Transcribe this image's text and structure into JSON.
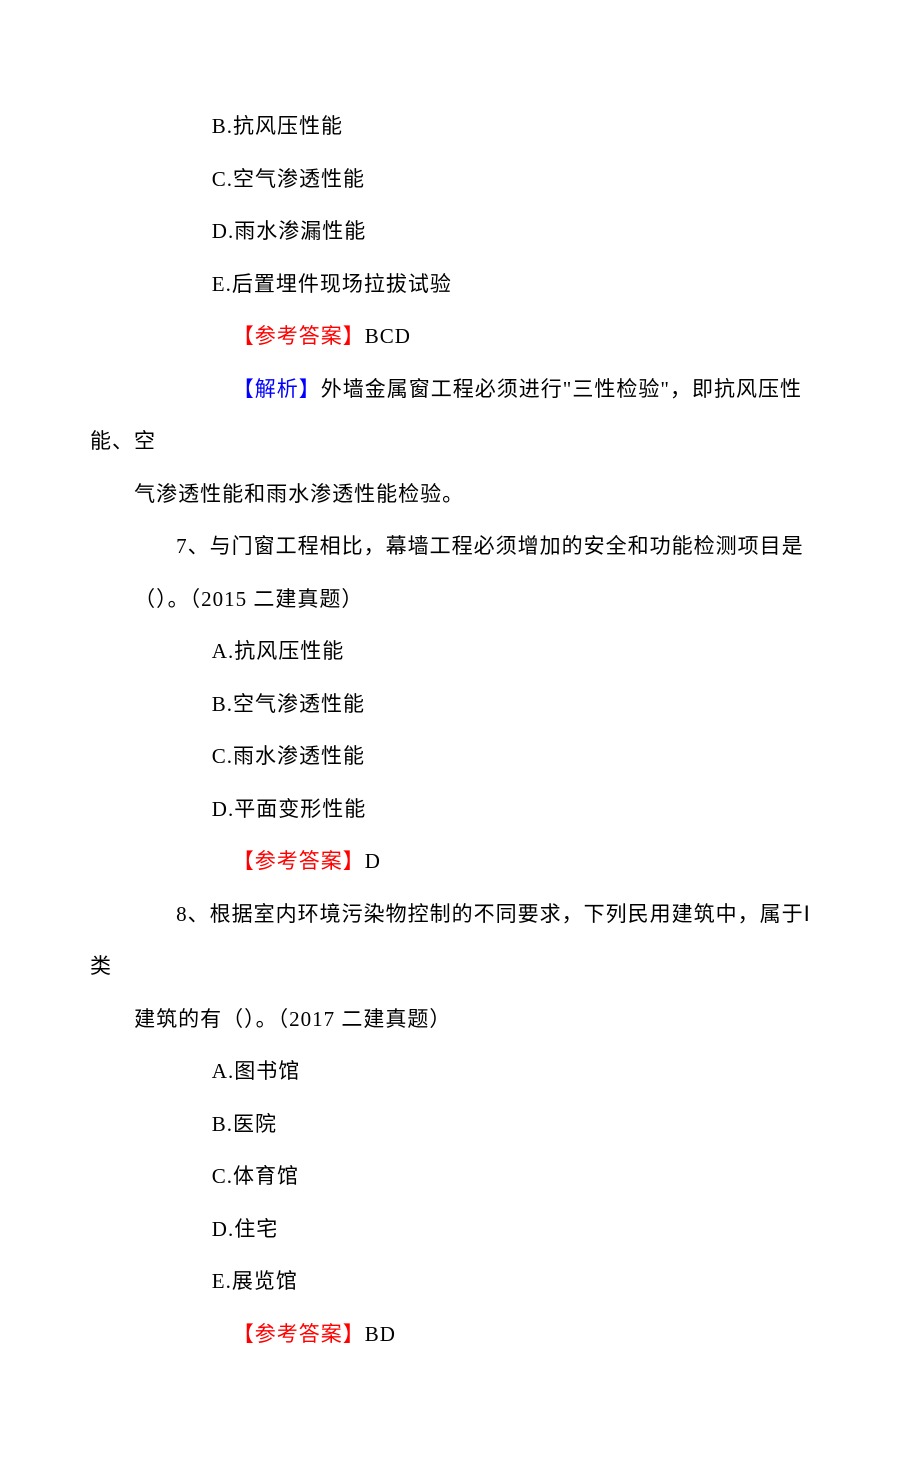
{
  "colors": {
    "red": "#ff0000",
    "blue": "#0000ff",
    "black": "#000000"
  },
  "lines": {
    "opt_b": "B.抗风压性能",
    "opt_c": "C.空气渗透性能",
    "opt_d": "D.雨水渗漏性能",
    "opt_e": "E.后置埋件现场拉拔试验",
    "ans6_label": "【参考答案】",
    "ans6_value": "BCD",
    "analysis_label": "【解析】",
    "analysis_part1": "外墙金属窗工程必须进行\"三性检验\"，即抗风压性能、空",
    "analysis_part2": "气渗透性能和雨水渗透性能检验。",
    "q7_part1": "7、与门窗工程相比，幕墙工程必须增加的安全和功能检测项目是",
    "q7_part2": "（）。（2015 二建真题）",
    "q7_a": "A.抗风压性能",
    "q7_b": "B.空气渗透性能",
    "q7_c": "C.雨水渗透性能",
    "q7_d": "D.平面变形性能",
    "ans7_label": "【参考答案】",
    "ans7_value": "D",
    "q8_part1": "8、根据室内环境污染物控制的不同要求，下列民用建筑中，属于Ⅰ类",
    "q8_part2": "建筑的有（）。（2017 二建真题）",
    "q8_a": "A.图书馆",
    "q8_b": "B.医院",
    "q8_c": "C.体育馆",
    "q8_d": "D.住宅",
    "q8_e": "E.展览馆",
    "ans8_label": "【参考答案】",
    "ans8_value": "BD"
  }
}
